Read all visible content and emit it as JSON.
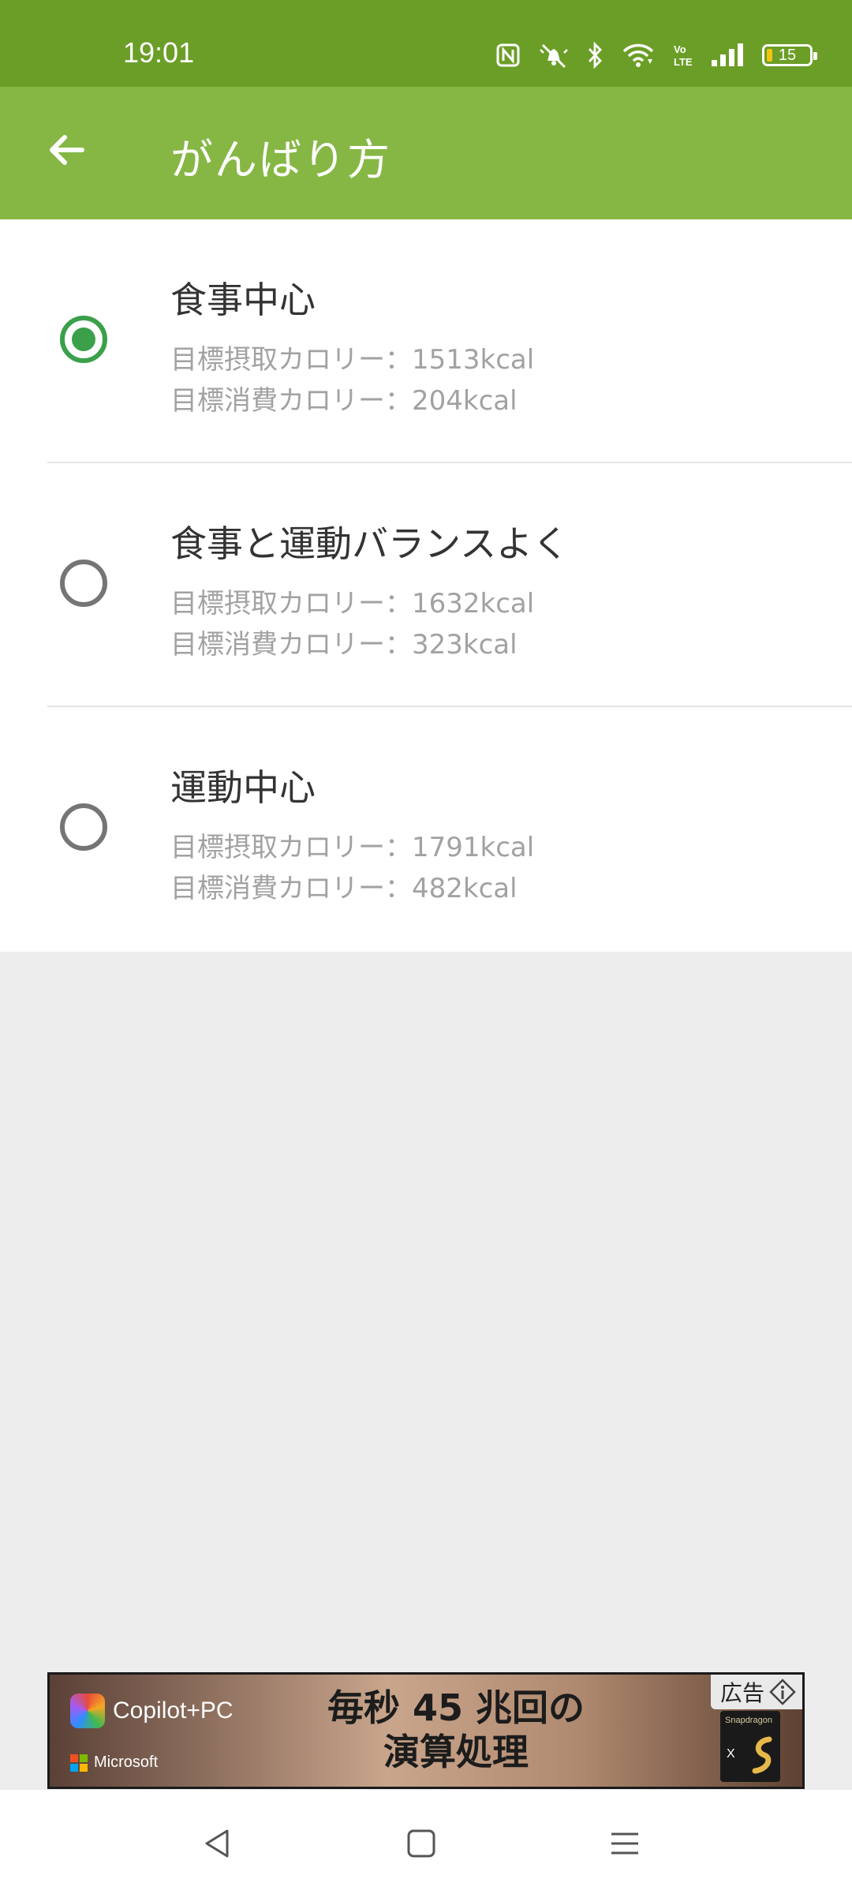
{
  "status_bar": {
    "time": "19:01",
    "battery_percent": "15",
    "volte_label": "Vo LTE"
  },
  "app_bar": {
    "title": "がんばり方"
  },
  "options": [
    {
      "title": "食事中心",
      "intake": "目標摂取カロリー：1513kcal",
      "burn": "目標消費カロリー：204kcal",
      "selected": true
    },
    {
      "title": "食事と運動バランスよく",
      "intake": "目標摂取カロリー：1632kcal",
      "burn": "目標消費カロリー：323kcal",
      "selected": false
    },
    {
      "title": "運動中心",
      "intake": "目標摂取カロリー：1791kcal",
      "burn": "目標消費カロリー：482kcal",
      "selected": false
    }
  ],
  "ad": {
    "brand": "Copilot+PC",
    "vendor": "Microsoft",
    "headline_line1": "毎秒 45 兆回の",
    "headline_line2": "演算処理",
    "ad_label": "広告",
    "chip_name": "Snapdragon",
    "chip_x": "X"
  },
  "colors": {
    "status_bar": "#6b9e27",
    "app_bar": "#86b745",
    "radio_selected": "#3aa04a",
    "radio_unselected": "#757575",
    "background": "#ededed"
  },
  "icons": {
    "back": "arrow-left-icon",
    "nfc": "nfc-icon",
    "mute": "bell-off-icon",
    "bluetooth": "bluetooth-icon",
    "wifi": "wifi-icon",
    "signal": "signal-icon",
    "nav_back": "triangle-back-icon",
    "nav_home": "square-home-icon",
    "nav_recents": "menu-lines-icon"
  }
}
